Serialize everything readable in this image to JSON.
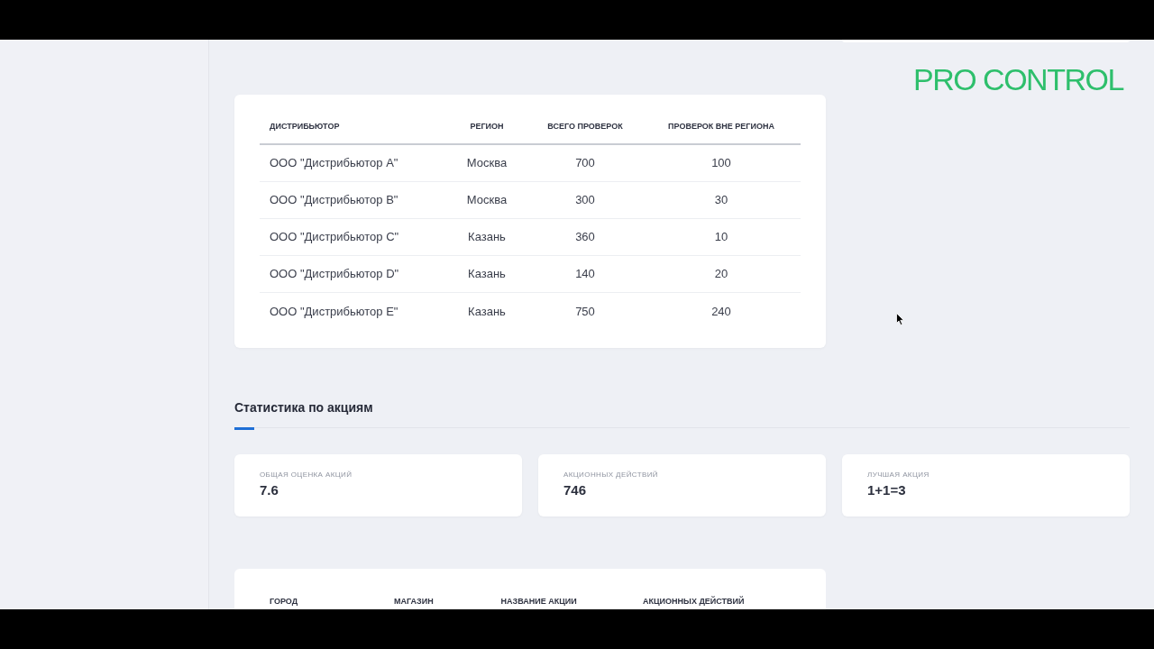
{
  "logo": {
    "text": "PRO CONTROL"
  },
  "distributor_table": {
    "columns": [
      "ДИСТРИБЬЮТОР",
      "РЕГИОН",
      "ВСЕГО ПРОВЕРОК",
      "ПРОВЕРОК ВНЕ РЕГИОНА"
    ],
    "rows": [
      {
        "cells": [
          "ООО \"Дистрибьютор A\"",
          "Москва",
          "700",
          "100"
        ]
      },
      {
        "cells": [
          "ООО \"Дистрибьютор B\"",
          "Москва",
          "300",
          "30"
        ]
      },
      {
        "cells": [
          "ООО \"Дистрибьютор C\"",
          "Казань",
          "360",
          "10"
        ]
      },
      {
        "cells": [
          "ООО \"Дистрибьютор D\"",
          "Казань",
          "140",
          "20"
        ]
      },
      {
        "cells": [
          "ООО \"Дистрибьютор E\"",
          "Казань",
          "750",
          "240"
        ]
      }
    ]
  },
  "promo_stats": {
    "title": "Статистика по акциям",
    "cards": [
      {
        "label": "ОБЩАЯ ОЦЕНКА АКЦИЙ",
        "value": "7.6"
      },
      {
        "label": "АКЦИОННЫХ ДЕЙСТВИЙ",
        "value": "746"
      },
      {
        "label": "ЛУЧШАЯ АКЦИЯ",
        "value": "1+1=3"
      }
    ]
  },
  "promo_table": {
    "columns": [
      "ГОРОД",
      "МАГАЗИН",
      "НАЗВАНИЕ АКЦИИ",
      "АКЦИОННЫХ ДЕЙСТВИЙ"
    ]
  }
}
